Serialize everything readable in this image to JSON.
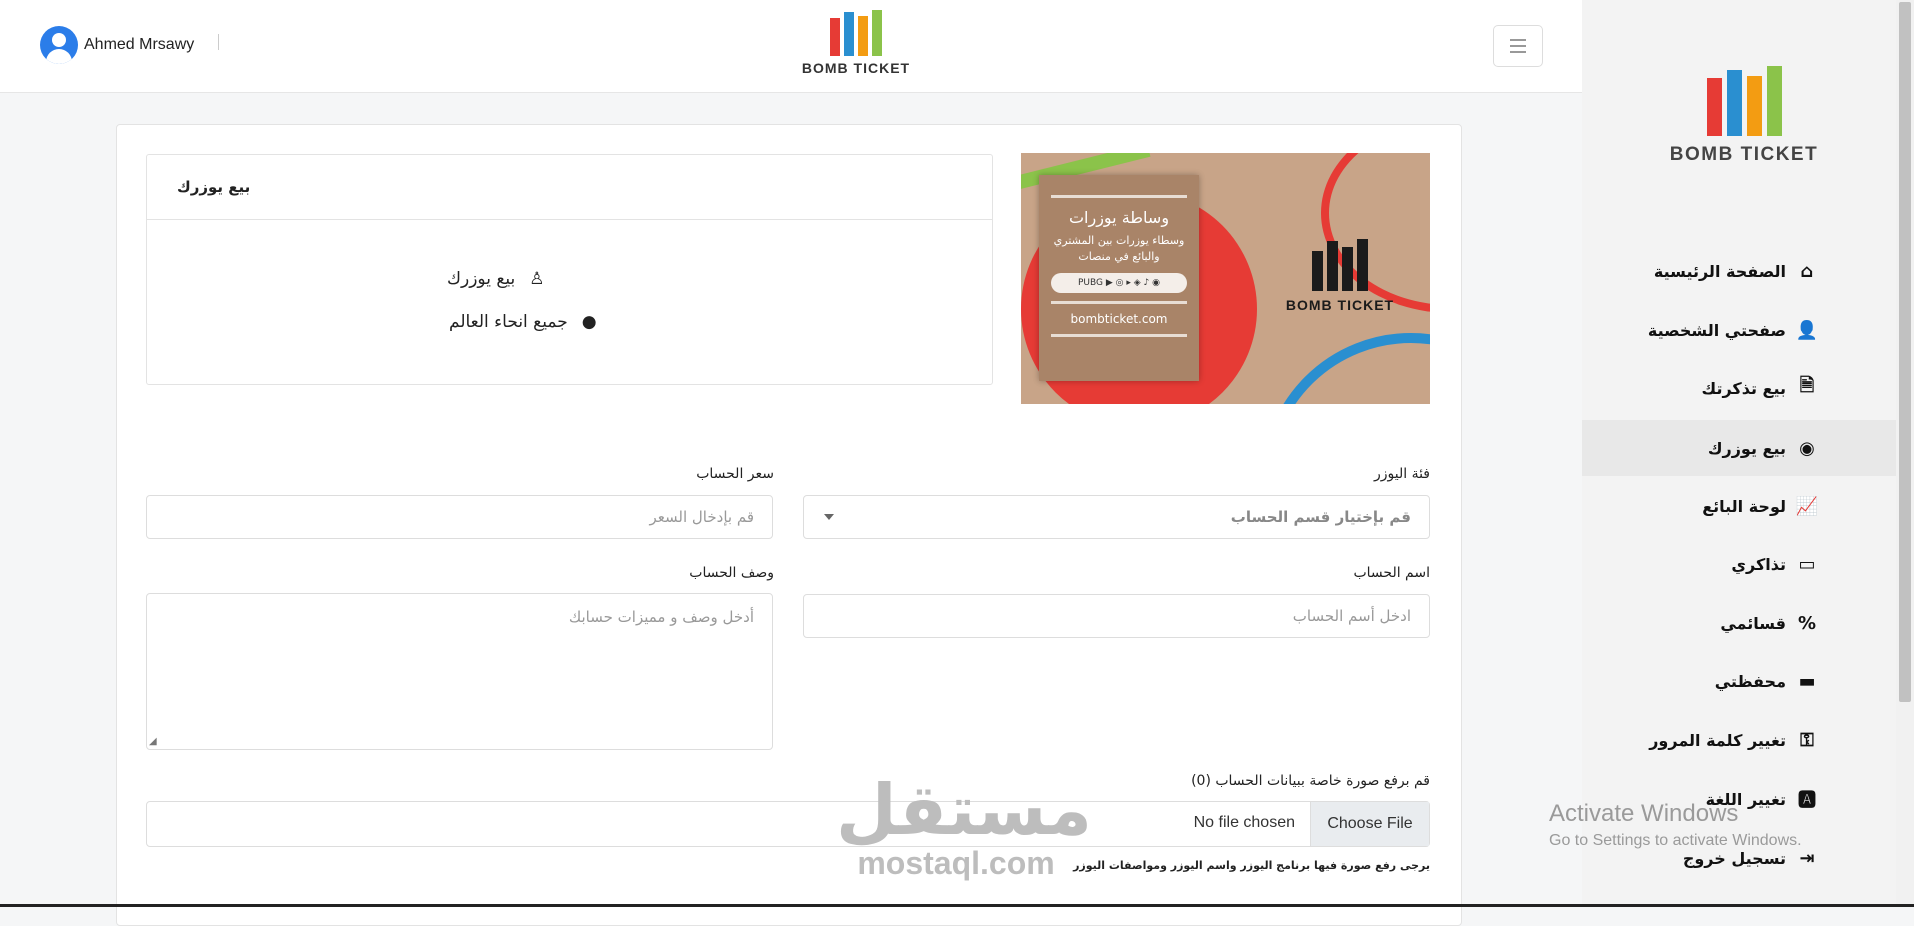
{
  "header": {
    "user_name": "Ahmed Mrsawy",
    "logo_text": "BOMB TICKET"
  },
  "brand_colors": [
    "#e63b35",
    "#2a8fd0",
    "#f39c12",
    "#8bc34a"
  ],
  "sidebar": {
    "logo_text": "BOMB TICKET",
    "items": [
      {
        "label": "الصفحة الرئيسية",
        "icon": "home-icon",
        "glyph": "⌂"
      },
      {
        "label": "صفحتي الشخصية",
        "icon": "user-icon",
        "glyph": "👤"
      },
      {
        "label": "بيع تذكرتك",
        "icon": "ticket-file-icon",
        "glyph": "🗎"
      },
      {
        "label": "بيع يوزرك",
        "icon": "user-circle-icon",
        "glyph": "◉"
      },
      {
        "label": "لوحة البائع",
        "icon": "chart-line-icon",
        "glyph": "📈"
      },
      {
        "label": "تذاكري",
        "icon": "ticket-icon",
        "glyph": "▭"
      },
      {
        "label": "قسائمي",
        "icon": "percent-icon",
        "glyph": "%"
      },
      {
        "label": "محفظتي",
        "icon": "wallet-icon",
        "glyph": "▬"
      },
      {
        "label": "تغيير كلمة المرور",
        "icon": "key-icon",
        "glyph": "⚿"
      },
      {
        "label": "تغيير اللغة",
        "icon": "language-icon",
        "glyph": "🅰"
      },
      {
        "label": "تسجيل خروج",
        "icon": "logout-icon",
        "glyph": "⇥"
      }
    ]
  },
  "info": {
    "title": "بيع يوزرك",
    "line1": "بيع يوزرك",
    "line2": "جميع انحاء العالم"
  },
  "banner": {
    "title": "وساطة يوزرات",
    "subtitle": "وسطاء يوزرات بين المشتري والبائع في منصات",
    "platforms": "PUBG ▶ ◎ ▸ ◈ ♪ ◉",
    "url": "bombticket.com",
    "logo_text": "BOMB TICKET"
  },
  "form": {
    "category_label": "فئة اليوزر",
    "category_placeholder": "قم بإختيار قسم الحساب",
    "price_label": "سعر الحساب",
    "price_placeholder": "قم بإدخال السعر",
    "name_label": "اسم الحساب",
    "name_placeholder": "ادخل أسم الحساب",
    "desc_label": "وصف الحساب",
    "desc_placeholder": "أدخل وصف و مميزات حسابك",
    "upload_label": "قم برفع صورة خاصة ببيانات الحساب (0)",
    "choose_file": "Choose File",
    "no_file": "No file chosen",
    "hint": "يرجى رفع صورة فيها برنامج اليوزر واسم اليوزر ومواصفات اليوزر"
  },
  "watermark": {
    "arabic": "مستقل",
    "latin": "mostaql.com"
  },
  "windows": {
    "line1": "Activate Windows",
    "line2": "Go to Settings to activate Windows."
  }
}
